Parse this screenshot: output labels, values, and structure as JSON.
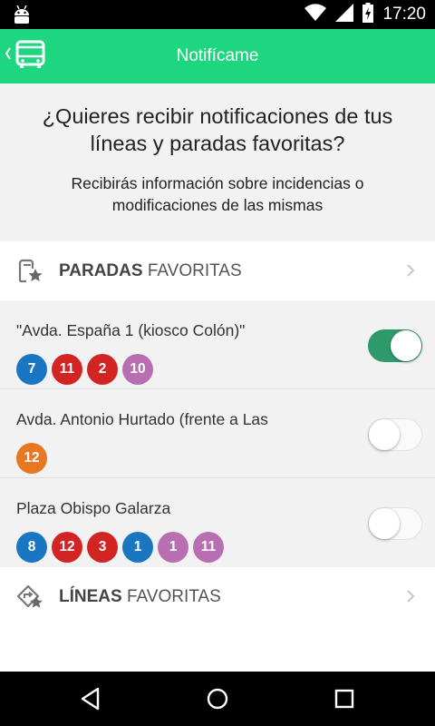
{
  "status_bar": {
    "time": "17:20",
    "icons": [
      "android-icon",
      "wifi-icon",
      "signal-icon",
      "battery-charging-icon"
    ]
  },
  "app_bar": {
    "title": "Notifícame",
    "back_icon": "bus-back-icon",
    "colors": {
      "background": "#1ed67f",
      "text": "#ffffff"
    }
  },
  "intro": {
    "question": "¿Quieres recibir notificaciones de tus líneas y paradas favoritas?",
    "description": "Recibirás información sobre incidencias o modificaciones de las mismas"
  },
  "stops_section": {
    "label_bold": "PARADAS",
    "label_rest": "FAVORITAS",
    "icon": "bus-stop-star-icon"
  },
  "stops": [
    {
      "name": "\"Avda. España 1 (kiosco Colón)\"",
      "enabled": true,
      "lines": [
        {
          "number": "7",
          "color": "#1a76c0"
        },
        {
          "number": "11",
          "color": "#d32424"
        },
        {
          "number": "2",
          "color": "#d32424"
        },
        {
          "number": "10",
          "color": "#b86fb2"
        }
      ]
    },
    {
      "name": "Avda. Antonio Hurtado (frente a Las",
      "enabled": false,
      "lines": [
        {
          "number": "12",
          "color": "#e87722"
        }
      ]
    },
    {
      "name": "Plaza Obispo Galarza",
      "enabled": false,
      "lines": [
        {
          "number": "8",
          "color": "#1a76c0"
        },
        {
          "number": "12",
          "color": "#d32424"
        },
        {
          "number": "3",
          "color": "#d32424"
        },
        {
          "number": "1",
          "color": "#1a76c0"
        },
        {
          "number": "1",
          "color": "#b86fb2"
        },
        {
          "number": "11",
          "color": "#b86fb2"
        }
      ]
    }
  ],
  "lines_section": {
    "label_bold": "LÍNEAS",
    "label_rest": "FAVORITAS",
    "icon": "route-star-icon"
  },
  "nav_bar": {
    "icons": [
      "back-triangle-icon",
      "home-circle-icon",
      "recents-square-icon"
    ]
  },
  "colors": {
    "accent": "#1ed67f",
    "toggle_on": "#2e9a6c"
  }
}
